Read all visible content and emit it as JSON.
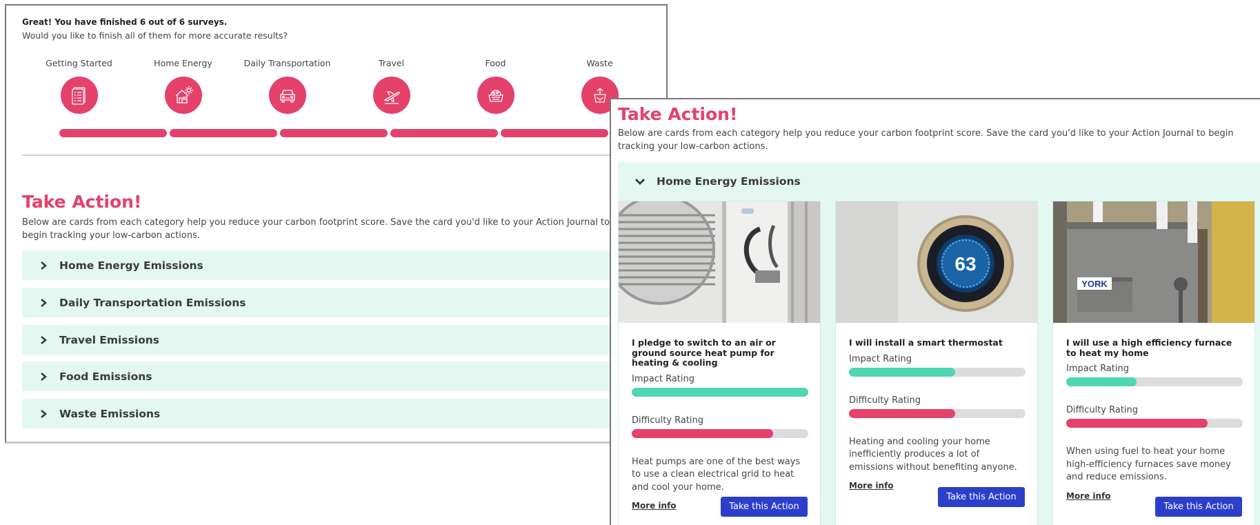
{
  "survey": {
    "status": "Great! You have finished 6 out of 6 surveys.",
    "prompt": "Would you like to finish all of them for more accurate results?",
    "progress_fraction": 1.0,
    "steps": [
      {
        "label": "Getting Started",
        "icon": "checklist-icon"
      },
      {
        "label": "Home Energy",
        "icon": "house-sun-icon"
      },
      {
        "label": "Daily Transportation",
        "icon": "car-icon"
      },
      {
        "label": "Travel",
        "icon": "airplane-icon"
      },
      {
        "label": "Food",
        "icon": "food-basket-icon"
      },
      {
        "label": "Waste",
        "icon": "recycling-icon"
      }
    ]
  },
  "take_action": {
    "title": "Take Action!",
    "description": "Below are cards from each category help you reduce your carbon footprint score. Save the card you'd like to your Action Journal to begin tracking your low-carbon actions.",
    "categories": [
      "Home Energy Emissions",
      "Daily Transportation Emissions",
      "Travel Emissions",
      "Food Emissions",
      "Waste Emissions"
    ]
  },
  "expanded": {
    "category": "Home Energy Emissions",
    "cards": [
      {
        "title": "I pledge to switch to an air or ground source heat pump for heating & cooling",
        "impact_label": "Impact Rating",
        "impact": 1.0,
        "difficulty_label": "Difficulty Rating",
        "difficulty": 0.8,
        "description": "Heat pumps are one of the best ways to use a clean electrical grid to heat and cool your home.",
        "more_info": "More info",
        "cta": "Take this Action",
        "image": "heat-pump-photo"
      },
      {
        "title": "I will install a smart thermostat",
        "impact_label": "Impact Rating",
        "impact": 0.6,
        "difficulty_label": "Difficulty Rating",
        "difficulty": 0.6,
        "description": "Heating and cooling your home inefficiently produces a lot of emissions without benefiting anyone.",
        "more_info": "More info",
        "cta": "Take this Action",
        "image": "smart-thermostat-photo",
        "thermostat_reading": "63"
      },
      {
        "title": "I will use a high efficiency furnace to heat my home",
        "impact_label": "Impact Rating",
        "impact": 0.4,
        "difficulty_label": "Difficulty Rating",
        "difficulty": 0.8,
        "description": "When using fuel to heat your home high-efficiency furnaces save money and reduce emissions.",
        "more_info": "More info",
        "cta": "Take this Action",
        "image": "furnace-photo",
        "brand_label": "YORK"
      }
    ]
  },
  "colors": {
    "accent": "#e4416b",
    "panel_bg": "#e3f8f1",
    "impact": "#4fd6b3",
    "difficulty": "#e4416b",
    "button": "#2b3fcb"
  }
}
